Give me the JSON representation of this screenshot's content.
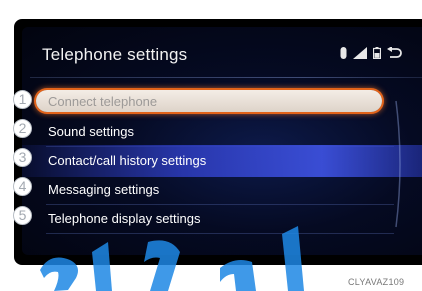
{
  "header": {
    "title": "Telephone settings"
  },
  "status_icons": [
    "bluetooth-icon",
    "signal-strength-icon",
    "battery-icon",
    "back-icon"
  ],
  "menu": {
    "items": [
      {
        "number": "1",
        "label": "Connect telephone",
        "state": "selected"
      },
      {
        "number": "2",
        "label": "Sound settings"
      },
      {
        "number": "3",
        "label": "Contact/call history settings"
      },
      {
        "number": "4",
        "label": "Messaging settings"
      },
      {
        "number": "5",
        "label": "Telephone display settings"
      }
    ]
  },
  "image_code": "CLYAVAZ109",
  "colors": {
    "accent": "#e2631a",
    "highlight": "#3c50dc",
    "watermark": "#1e88e5"
  }
}
